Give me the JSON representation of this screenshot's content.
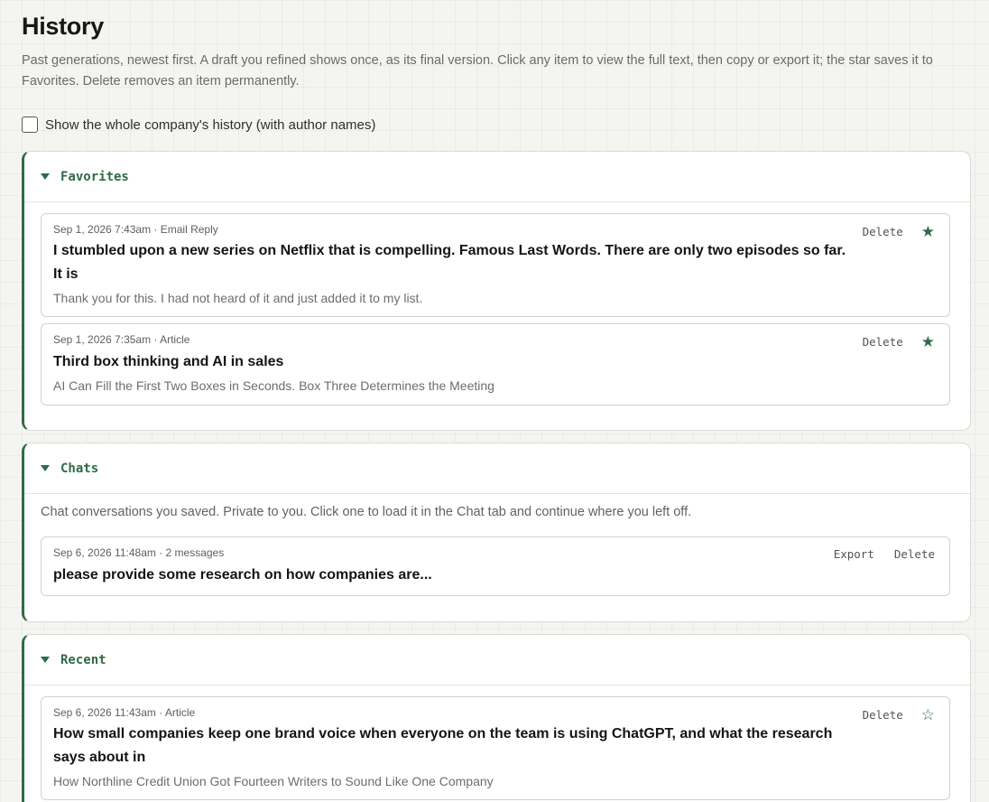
{
  "page": {
    "title": "History",
    "intro": "Past generations, newest first. A draft you refined shows once, as its final version. Click any item to view the full text, then copy or export it; the star saves it to Favorites. Delete removes an item permanently.",
    "company_toggle_label": "Show the whole company's history (with author names)",
    "company_toggle_checked": false
  },
  "colors": {
    "accent": "#2f6b46",
    "background": "#f4f5f1"
  },
  "favorites": {
    "label": "Favorites",
    "items": [
      {
        "meta": "Sep 1, 2026 7:43am · Email Reply",
        "title": "I stumbled upon a new series on Netflix that is compelling. Famous Last Words. There are only two episodes so far. It is",
        "snippet": "Thank you for this. I had not heard of it and just added it to my list.",
        "delete_label": "Delete",
        "star_icon": "star-filled-icon",
        "star_glyph": "★"
      },
      {
        "meta": "Sep 1, 2026 7:35am · Article",
        "title": "Third box thinking and AI in sales",
        "snippet": "AI Can Fill the First Two Boxes in Seconds. Box Three Determines the Meeting",
        "delete_label": "Delete",
        "star_icon": "star-filled-icon",
        "star_glyph": "★"
      }
    ]
  },
  "chats": {
    "label": "Chats",
    "description": "Chat conversations you saved. Private to you. Click one to load it in the Chat tab and continue where you left off.",
    "items": [
      {
        "meta": "Sep 6, 2026 11:48am · 2 messages",
        "title": "please provide some research on how companies are...",
        "export_label": "Export",
        "delete_label": "Delete"
      }
    ]
  },
  "recent": {
    "label": "Recent",
    "items": [
      {
        "meta": "Sep 6, 2026 11:43am · Article",
        "title": "How small companies keep one brand voice when everyone on the team is using ChatGPT, and what the research says about in",
        "snippet": "How Northline Credit Union Got Fourteen Writers to Sound Like One Company",
        "delete_label": "Delete",
        "star_icon": "star-outline-icon",
        "star_glyph": "☆"
      }
    ]
  }
}
